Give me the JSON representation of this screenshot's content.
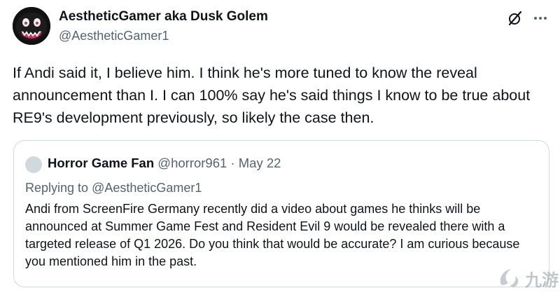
{
  "author": {
    "name": "AestheticGamer aka Dusk Golem",
    "handle": "@AestheticGamer1"
  },
  "icons": {
    "avatar": "monster-face-avatar",
    "grok": "grok-icon",
    "more": "more-horizontal-icon",
    "quote_avatar": "default-avatar-icon",
    "watermark": "jiuyou-logo-watermark"
  },
  "tweet": {
    "text": "If Andi said it, I believe him. I think he's more tuned to know the reveal announcement than I. I can 100% say he's said things I know to be true about RE9's development previously, so likely the case then."
  },
  "quote": {
    "name": "Horror Game Fan",
    "handle": "@horror961",
    "separator": " · ",
    "date": "May 22",
    "replying_prefix": "Replying to ",
    "replying_to": "@AestheticGamer1",
    "text": "Andi from ScreenFire Germany recently did a video about games he thinks will be announced at Summer Game Fest and  Resident Evil 9 would be revealed there with a targeted release of Q1 2026. Do you think that would be accurate? I am curious because you mentioned him in the past."
  },
  "watermark": {
    "text": "九游"
  },
  "colors": {
    "text_primary": "#0f1419",
    "text_secondary": "#536471",
    "border": "#cfd9de",
    "avatar_bg": "#111111",
    "avatar_accent": "#e0245e"
  }
}
